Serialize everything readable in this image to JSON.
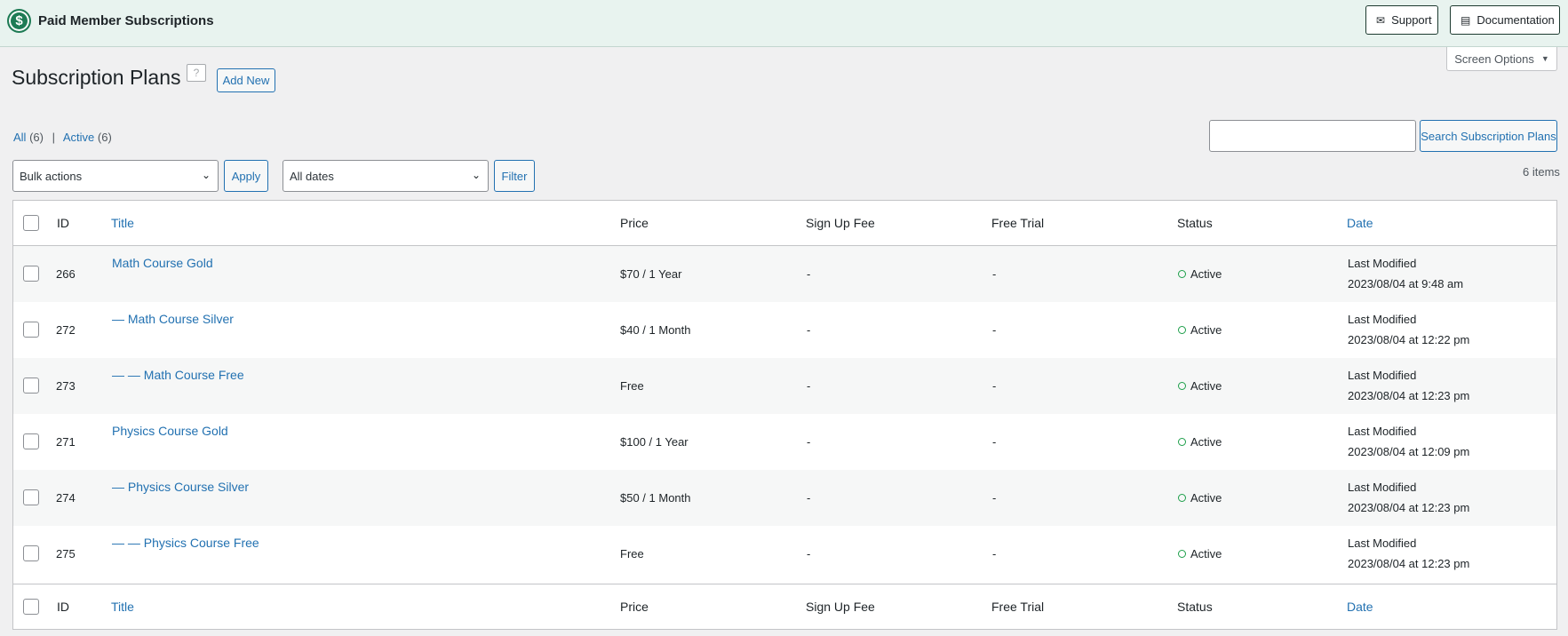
{
  "header": {
    "brand_name": "Paid Member Subscriptions",
    "support_label": "Support",
    "docs_label": "Documentation"
  },
  "screen_options_label": "Screen Options",
  "page_title": "Subscription Plans",
  "help_glyph": "?",
  "add_new_label": "Add New",
  "views": {
    "all_label": "All",
    "all_count": "(6)",
    "separator": "|",
    "active_label": "Active",
    "active_count": "(6)"
  },
  "search_button_label": "Search Subscription Plans",
  "bulk_actions": {
    "selected": "Bulk actions",
    "apply_label": "Apply"
  },
  "date_filter": {
    "selected": "All dates",
    "filter_label": "Filter"
  },
  "items_count": "6 items",
  "columns": {
    "id": "ID",
    "title": "Title",
    "price": "Price",
    "signup_fee": "Sign Up Fee",
    "free_trial": "Free Trial",
    "status": "Status",
    "date": "Date"
  },
  "rows": [
    {
      "id": "266",
      "title": "Math Course Gold",
      "price": "$70 / 1 Year",
      "signup_fee": "-",
      "free_trial": "-",
      "status": "Active",
      "date_label": "Last Modified",
      "date_value": "2023/08/04 at 9:48 am"
    },
    {
      "id": "272",
      "title": "— Math Course Silver",
      "price": "$40 / 1 Month",
      "signup_fee": "-",
      "free_trial": "-",
      "status": "Active",
      "date_label": "Last Modified",
      "date_value": "2023/08/04 at 12:22 pm"
    },
    {
      "id": "273",
      "title": "— — Math Course Free",
      "price": "Free",
      "signup_fee": "-",
      "free_trial": "-",
      "status": "Active",
      "date_label": "Last Modified",
      "date_value": "2023/08/04 at 12:23 pm"
    },
    {
      "id": "271",
      "title": "Physics Course Gold",
      "price": "$100 / 1 Year",
      "signup_fee": "-",
      "free_trial": "-",
      "status": "Active",
      "date_label": "Last Modified",
      "date_value": "2023/08/04 at 12:09 pm"
    },
    {
      "id": "274",
      "title": "— Physics Course Silver",
      "price": "$50 / 1 Month",
      "signup_fee": "-",
      "free_trial": "-",
      "status": "Active",
      "date_label": "Last Modified",
      "date_value": "2023/08/04 at 12:23 pm"
    },
    {
      "id": "275",
      "title": "— — Physics Course Free",
      "price": "Free",
      "signup_fee": "-",
      "free_trial": "-",
      "status": "Active",
      "date_label": "Last Modified",
      "date_value": "2023/08/04 at 12:23 pm"
    }
  ],
  "colors": {
    "accent": "#2271b1",
    "brand": "#1e7b55",
    "active_status": "#1d9f4a",
    "topbar_bg": "#e8f3ef"
  }
}
